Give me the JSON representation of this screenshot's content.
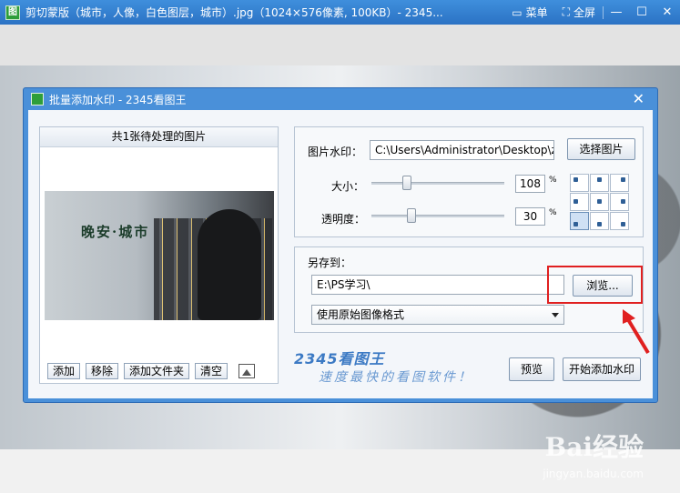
{
  "app": {
    "title": "剪切蒙版（城市，人像，白色图层，城市）.jpg（1024×576像素, 100KB）- 2345...",
    "menu_label": "菜单",
    "fullscreen_label": "全屏"
  },
  "dialog": {
    "title": "批量添加水印 - 2345看图王",
    "close_glyph": "✕"
  },
  "left": {
    "header": "共1张待处理的图片",
    "thumb_text": "晚安·城市",
    "buttons": {
      "add": "添加",
      "remove": "移除",
      "add_folder": "添加文件夹",
      "clear": "清空"
    }
  },
  "watermark": {
    "image_label": "图片水印：",
    "image_path": "C:\\Users\\Administrator\\Desktop\\z",
    "choose_button": "选择图片",
    "size_label": "大小：",
    "size_value": "108",
    "size_unit": "%",
    "size_fraction": 0.27,
    "opacity_label": "透明度：",
    "opacity_value": "30",
    "opacity_unit": "%",
    "opacity_fraction": 0.3,
    "position_selected": "bottom-left"
  },
  "save": {
    "save_to_label": "另存到：",
    "save_path": "E:\\PS学习\\",
    "browse_button": "浏览...",
    "format_option": "使用原始图像格式"
  },
  "footer": {
    "brand": "2345看图王",
    "slogan": "速度最快的看图软件！",
    "preview_button": "预览",
    "start_button": "开始添加水印"
  },
  "watermark_site": {
    "baidu": "Bai经验",
    "url": "jingyan.baidu.com"
  },
  "colors": {
    "titlebar": "#2b72c4",
    "dialog_frame": "#4a90d9",
    "highlight": "#e02020",
    "brand": "#3c7ac4"
  }
}
